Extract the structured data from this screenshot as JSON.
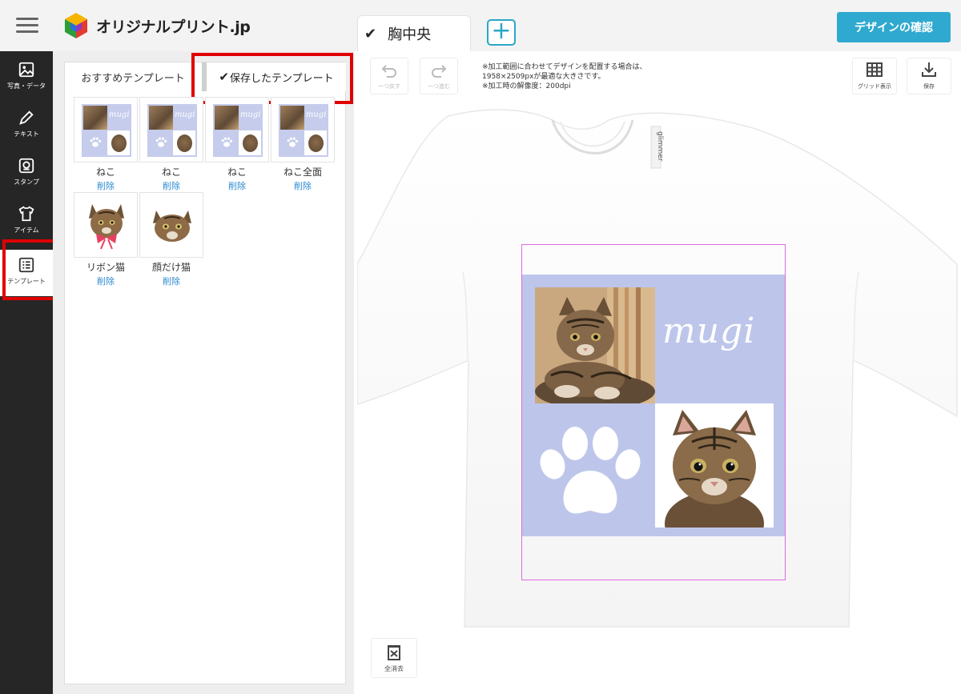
{
  "header": {
    "logo_text": "オリジナルプリント.jp",
    "view_tab_label": "胸中央",
    "add_tab_label": "+",
    "confirm_button": "デザインの確認"
  },
  "sidebar": {
    "items": [
      {
        "label": "写真・データ",
        "icon": "image-icon"
      },
      {
        "label": "テキスト",
        "icon": "pen-icon"
      },
      {
        "label": "スタンプ",
        "icon": "stamp-icon"
      },
      {
        "label": "アイテム",
        "icon": "tshirt-icon"
      },
      {
        "label": "テンプレート",
        "icon": "template-icon"
      }
    ],
    "active_index": 4
  },
  "panel": {
    "tabs": [
      {
        "label": "おすすめテンプレート"
      },
      {
        "label": "保存したテンプレート",
        "selected": true
      }
    ],
    "templates": [
      {
        "name": "ねこ",
        "delete_label": "削除"
      },
      {
        "name": "ねこ",
        "delete_label": "削除"
      },
      {
        "name": "ねこ",
        "delete_label": "削除"
      },
      {
        "name": "ねこ全面",
        "delete_label": "削除"
      },
      {
        "name": "リボン猫",
        "delete_label": "削除"
      },
      {
        "name": "顔だけ猫",
        "delete_label": "削除"
      }
    ],
    "mini_text": "mugi"
  },
  "toolbar": {
    "undo_label": "一つ戻す",
    "redo_label": "一つ進む",
    "grid_label": "グリッド表示",
    "save_label": "保存",
    "note_lines": [
      "※加工範囲に合わせてデザインを配置する場合は、",
      "1958×2509pxが最適な大きさです。",
      "※加工時の解像度：200dpi"
    ],
    "clear_label": "全消去"
  },
  "design": {
    "text": "mugi",
    "shirt_label": "glimmer",
    "background_color": "#bdc6ea"
  },
  "colors": {
    "accent": "#2fa9cf",
    "highlight": "#e00000",
    "sidebar": "#262626",
    "link": "#2b8bd0"
  }
}
